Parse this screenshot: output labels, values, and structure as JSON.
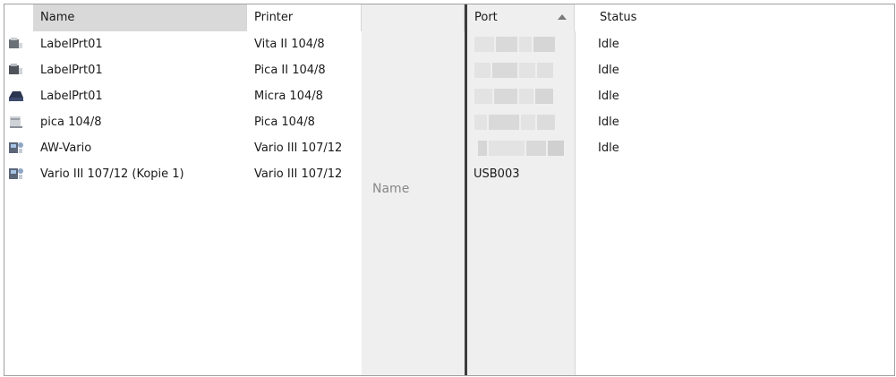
{
  "header": {
    "columns": [
      {
        "label": "Name"
      },
      {
        "label": "Printer"
      },
      {
        "label": ""
      },
      {
        "label": "Port"
      },
      {
        "label": "Status"
      }
    ]
  },
  "drag_column_label": "Name",
  "rows": [
    {
      "icon": "printer-icon",
      "name": "LabelPrt01",
      "printer": "Vita II 104/8",
      "port": "",
      "status": "Idle"
    },
    {
      "icon": "printer-icon",
      "name": "LabelPrt01",
      "printer": "Pica II 104/8",
      "port": "",
      "status": "Idle"
    },
    {
      "icon": "printer-icon",
      "name": "LabelPrt01",
      "printer": "Micra 104/8",
      "port": "",
      "status": "Idle"
    },
    {
      "icon": "printer-icon",
      "name": "pica 104/8",
      "printer": "Pica 104/8",
      "port": "",
      "status": "Idle"
    },
    {
      "icon": "network-printer-icon",
      "name": "AW-Vario",
      "printer": "Vario III 107/12",
      "port": "",
      "status": "Idle"
    },
    {
      "icon": "network-printer-icon",
      "name": "Vario III 107/12 (Kopie 1)",
      "printer": "Vario III 107/12",
      "port": "USB003",
      "status": ""
    }
  ],
  "colors": {
    "header_selected": "#d9d9d9",
    "drag_column": "#efefef",
    "divider": "#3c3c3c"
  }
}
